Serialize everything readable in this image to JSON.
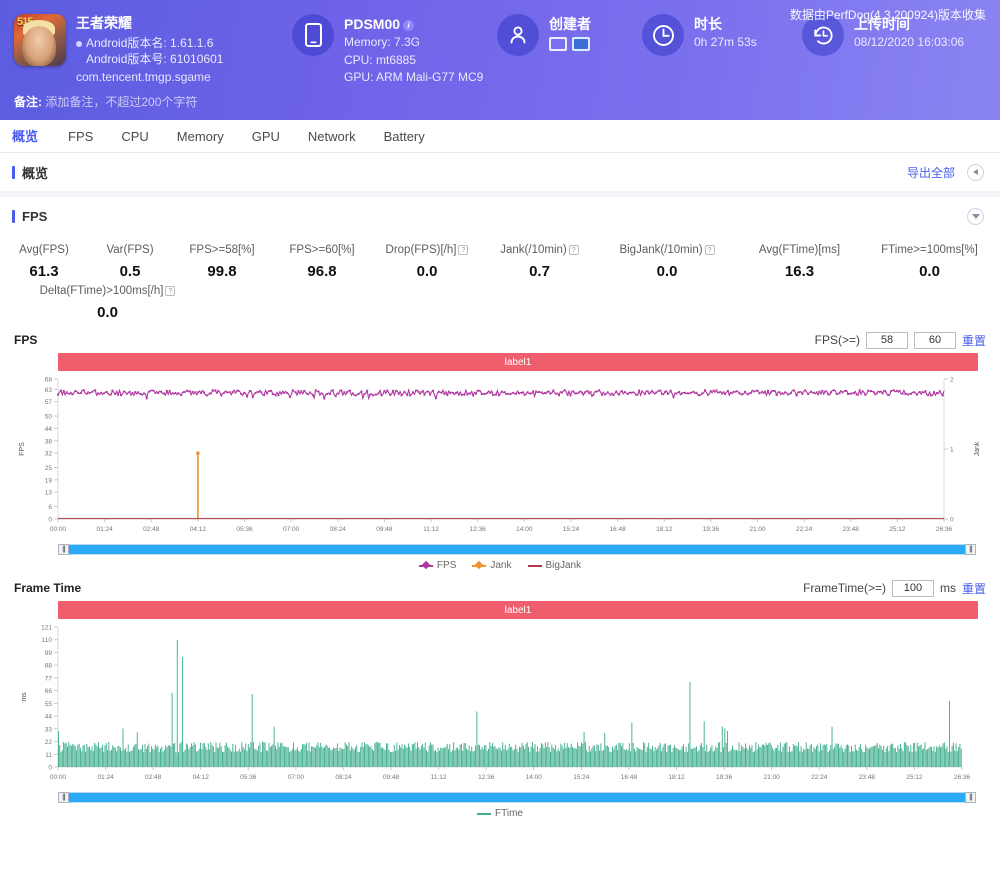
{
  "header": {
    "app": {
      "icon_badge": "515",
      "name": "王者荣耀",
      "version_name": "Android版本名: 1.61.1.6",
      "version_code": "Android版本号: 61010601",
      "package": "com.tencent.tmgp.sgame"
    },
    "device": {
      "icon": "phone-icon",
      "model": "PDSM00",
      "memory": "Memory: 7.3G",
      "cpu": "CPU: mt6885",
      "gpu": "GPU: ARM Mali-G77 MC9"
    },
    "creator": {
      "icon": "user-icon",
      "label": "创建者"
    },
    "duration": {
      "icon": "clock-icon",
      "label": "时长",
      "value": "0h 27m 53s"
    },
    "upload": {
      "icon": "history-icon",
      "label": "上传时间",
      "value": "08/12/2020 16:03:06"
    },
    "perfdog_note": "数据由PerfDog(4.3.200924)版本收集",
    "remark_label": "备注:",
    "remark_placeholder": "添加备注，不超过200个字符"
  },
  "tabs": [
    {
      "label": "概览",
      "active": true
    },
    {
      "label": "FPS",
      "active": false
    },
    {
      "label": "CPU",
      "active": false
    },
    {
      "label": "Memory",
      "active": false
    },
    {
      "label": "GPU",
      "active": false
    },
    {
      "label": "Network",
      "active": false
    },
    {
      "label": "Battery",
      "active": false
    }
  ],
  "overview": {
    "title": "概览",
    "export_all": "导出全部"
  },
  "fps_section": {
    "title": "FPS"
  },
  "stats": {
    "row1": [
      {
        "label": "Avg(FPS)",
        "value": "61.3",
        "help": false
      },
      {
        "label": "Var(FPS)",
        "value": "0.5",
        "help": false
      },
      {
        "label": "FPS>=58[%]",
        "value": "99.8",
        "help": false
      },
      {
        "label": "FPS>=60[%]",
        "value": "96.8",
        "help": false
      },
      {
        "label": "Drop(FPS)[/h]",
        "value": "0.0",
        "help": true
      },
      {
        "label": "Jank(/10min)",
        "value": "0.7",
        "help": true
      },
      {
        "label": "BigJank(/10min)",
        "value": "0.0",
        "help": true
      },
      {
        "label": "Avg(FTime)[ms]",
        "value": "16.3",
        "help": false
      },
      {
        "label": "FTime>=100ms[%]",
        "value": "0.0",
        "help": false
      }
    ],
    "row2": [
      {
        "label": "Delta(FTime)>100ms[/h]",
        "value": "0.0",
        "help": true
      }
    ]
  },
  "chart_data": [
    {
      "type": "line",
      "name": "FPS",
      "title": "FPS",
      "label_banner": "label1",
      "controls": {
        "label": "FPS(>=)",
        "value1": "58",
        "value2": "60",
        "reset": "重置"
      },
      "ylabel": "FPS",
      "y2label": "Jank",
      "yticks": [
        68,
        63,
        57,
        50,
        44,
        38,
        32,
        25,
        19,
        13,
        6,
        0
      ],
      "ylim": [
        0,
        68
      ],
      "y2ticks": [
        2,
        1,
        0
      ],
      "y2lim": [
        0,
        2
      ],
      "xlabel": "",
      "xticks": [
        "00:00",
        "01:24",
        "02:48",
        "04:12",
        "05:36",
        "07:00",
        "08:24",
        "09:48",
        "11:12",
        "12:36",
        "14:00",
        "15:24",
        "16:48",
        "18:12",
        "19:36",
        "21:00",
        "22:24",
        "23:48",
        "25:12",
        "26:36"
      ],
      "legend": [
        {
          "name": "FPS",
          "color": "#b0379f",
          "marker": "diamond"
        },
        {
          "name": "Jank",
          "color": "#f0922f",
          "marker": "diamond"
        },
        {
          "name": "BigJank",
          "color": "#b03a4b",
          "marker": "line"
        }
      ],
      "series": [
        {
          "name": "FPS",
          "color": "#b0379f",
          "approx_mean": 61.3,
          "approx_min": 57,
          "approx_max": 63
        },
        {
          "name": "Jank",
          "color": "#f0922f",
          "spikes": [
            {
              "x": "04:12",
              "value": 1
            }
          ]
        },
        {
          "name": "BigJank",
          "color": "#b03a4b",
          "values_all_zero": true
        }
      ],
      "grid": false,
      "legend_position": "bottom"
    },
    {
      "type": "bar",
      "name": "FrameTime",
      "title": "Frame Time",
      "label_banner": "label1",
      "controls": {
        "label": "FrameTime(>=)",
        "value1": "100",
        "unit": "ms",
        "reset": "重置"
      },
      "ylabel": "ms",
      "yticks": [
        121,
        110,
        99,
        88,
        77,
        66,
        55,
        44,
        33,
        22,
        11,
        0
      ],
      "ylim": [
        0,
        121
      ],
      "xticks": [
        "00:00",
        "01:24",
        "02:48",
        "04:12",
        "05:36",
        "07:00",
        "08:24",
        "09:48",
        "11:12",
        "12:36",
        "14:00",
        "15:24",
        "16:48",
        "18:12",
        "19:36",
        "21:00",
        "22:24",
        "23:48",
        "25:12",
        "26:36"
      ],
      "legend": [
        {
          "name": "FTime",
          "color": "#3fae8e",
          "marker": "line"
        }
      ],
      "series": [
        {
          "name": "FTime",
          "color": "#3fae8e",
          "approx_mean": 16.3,
          "approx_max": 110
        }
      ],
      "grid": false,
      "legend_position": "bottom"
    }
  ],
  "colors": {
    "accent": "#4a5cf0",
    "header_bg": "#6f63e8",
    "banner": "#ef5e6d",
    "fps_line": "#b0379f",
    "jank": "#f0922f",
    "bigjank": "#b03a4b",
    "ftime": "#3fae8e",
    "scrollbar": "#2aa9f5"
  }
}
